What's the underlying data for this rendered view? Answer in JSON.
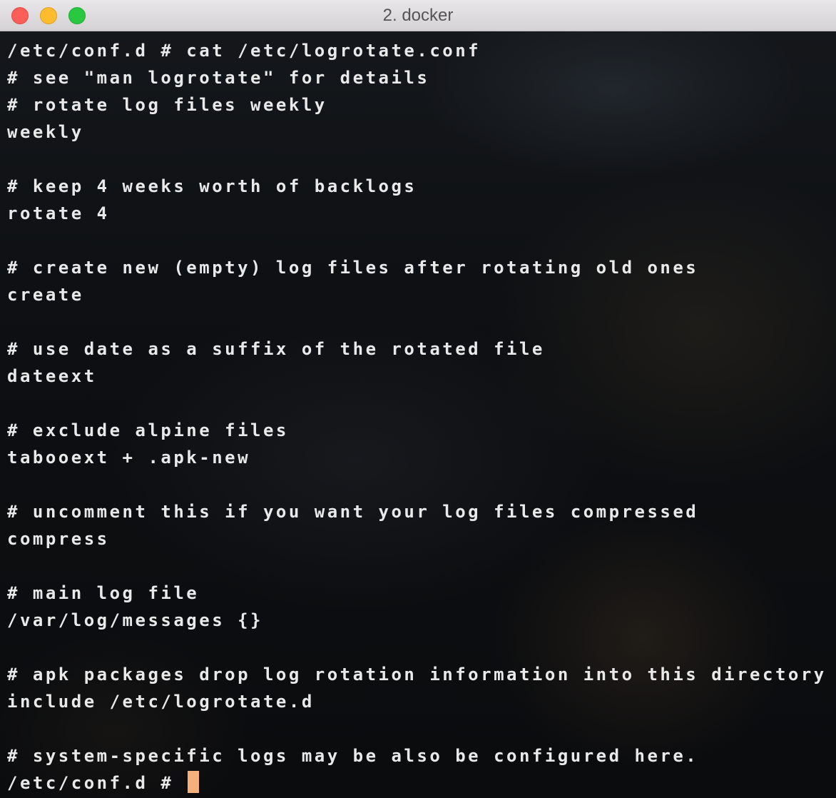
{
  "window": {
    "title": "2. docker"
  },
  "terminal": {
    "lines": [
      "/etc/conf.d # cat /etc/logrotate.conf",
      "# see \"man logrotate\" for details",
      "# rotate log files weekly",
      "weekly",
      "",
      "# keep 4 weeks worth of backlogs",
      "rotate 4",
      "",
      "# create new (empty) log files after rotating old ones",
      "create",
      "",
      "# use date as a suffix of the rotated file",
      "dateext",
      "",
      "# exclude alpine files",
      "tabooext + .apk-new",
      "",
      "# uncomment this if you want your log files compressed",
      "compress",
      "",
      "# main log file",
      "/var/log/messages {}",
      "",
      "# apk packages drop log rotation information into this directory",
      "include /etc/logrotate.d",
      "",
      "# system-specific logs may be also be configured here."
    ],
    "prompt": "/etc/conf.d # ",
    "colors": {
      "text": "#e9e9e9",
      "cursor": "#f6b07c"
    }
  }
}
